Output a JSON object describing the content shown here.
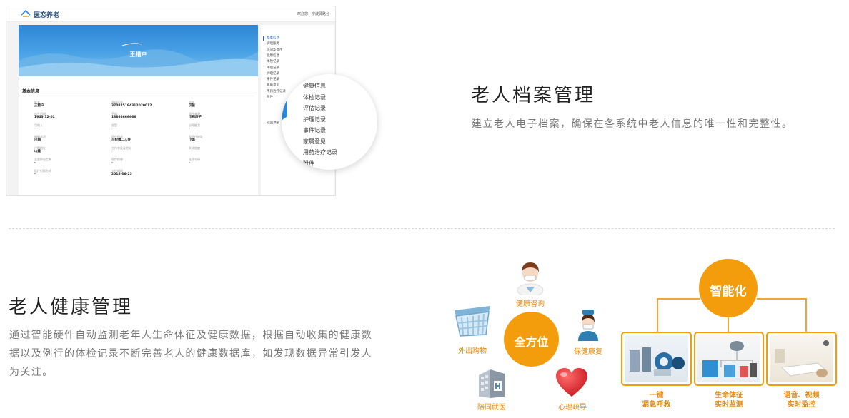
{
  "app_screenshot": {
    "brand": "医恋养老",
    "welcome": "欢迎您，宁波驿路台",
    "person_name": "王猎户",
    "section_title": "基本信息",
    "fields": [
      {
        "k": "姓名",
        "v": "王猎户"
      },
      {
        "k": "身份证号",
        "v": "370825194312020012"
      },
      {
        "k": "民族",
        "v": "汉族"
      },
      {
        "k": "出生日期",
        "v": "1943-12-02"
      },
      {
        "k": "手机",
        "v": "13666666666"
      },
      {
        "k": "居所来源",
        "v": "出租房子"
      },
      {
        "k": "月收入",
        "v": "-"
      },
      {
        "k": "血型",
        "v": "-"
      },
      {
        "k": "自理能力",
        "v": "-"
      },
      {
        "k": "婚姻状况",
        "v": "已婚"
      },
      {
        "k": "居住情况",
        "v": "与配偶二人住"
      },
      {
        "k": "现居住地址",
        "v": "小城"
      },
      {
        "k": "户籍地址",
        "v": "山童"
      },
      {
        "k": "工作单位及地址",
        "v": "-"
      },
      {
        "k": "文化程度",
        "v": "-"
      },
      {
        "k": "主要职业工种",
        "v": "-"
      },
      {
        "k": "医疗保障",
        "v": "-"
      },
      {
        "k": "社保号码",
        "v": "-"
      },
      {
        "k": "医疗付款方式",
        "v": "-"
      },
      {
        "k": "入住时间",
        "v": "2018-06-23"
      }
    ],
    "side_menu": [
      "基本信息",
      "护理服务",
      "房间及费用",
      "健康信息",
      "体检记录",
      "评估记录",
      "护理记录",
      "事件记录",
      "家属意见",
      "用药治疗记录",
      "附件",
      "返回顶部"
    ],
    "zoom_menu": [
      "健康信息",
      "体检记录",
      "评估记录",
      "护理记录",
      "事件记录",
      "家属意见",
      "用药治疗记录",
      "附件"
    ]
  },
  "section1": {
    "title": "老人档案管理",
    "desc": "建立老人电子档案，确保在各系统中老人信息的唯一性和完整性。"
  },
  "section2": {
    "title": "老人健康管理",
    "desc": "通过智能硬件自动监测老年人生命体征及健康数据，根据自动收集的健康数据以及例行的体检记录不断完善老人的健康数据库，如发现数据异常引发人为关注。"
  },
  "cluster": {
    "center": "全方位",
    "items": [
      "健康咨询",
      "外出购物",
      "保健康复",
      "陪同就医",
      "心理疏导"
    ]
  },
  "smart": {
    "center": "智能化",
    "boxes": [
      {
        "line1": "一键",
        "line2": "紧急呼救"
      },
      {
        "line1": "生命体征",
        "line2": "实时监测"
      },
      {
        "line1": "语音、视频",
        "line2": "实时监控"
      }
    ]
  },
  "colors": {
    "accent": "#f39c0c",
    "blue": "#2e86d6"
  }
}
